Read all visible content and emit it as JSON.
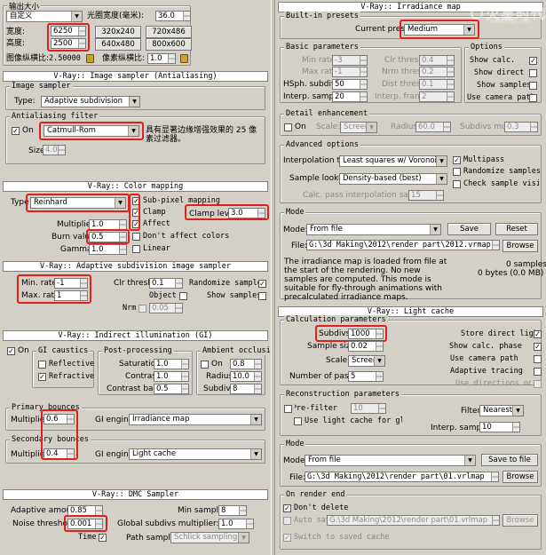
{
  "output": {
    "title": "输出大小",
    "preset": "自定义",
    "aperture_label": "光圈宽度(毫米):",
    "aperture": "36.0",
    "width_label": "宽度:",
    "width": "6250",
    "height_label": "高度:",
    "height": "2500",
    "res": [
      "320x240",
      "720x486",
      "640x480",
      "800x600"
    ],
    "img_aspect_label": "图像纵横比:",
    "img_aspect": "2.50000",
    "px_aspect_label": "像素纵横比:",
    "px_aspect": "1.0"
  },
  "image_sampler": {
    "rollout": "V-Ray:: Image sampler (Antialiasing)",
    "group": "Image sampler",
    "type_label": "Type:",
    "type": "Adaptive subdivision",
    "aa_group": "Antialiasing filter",
    "on_label": "On",
    "on_check": "✓",
    "filter": "Catmull-Rom",
    "desc": "具有显著边缘增强效果的 25 像素过滤器。",
    "size_label": "Size:",
    "size": "4.0"
  },
  "color_mapping": {
    "rollout": "V-Ray:: Color mapping",
    "type_label": "Type",
    "type": "Reinhard",
    "multiplier_label": "Multiplier:",
    "multiplier": "1.0",
    "burn_label": "Burn value:",
    "burn": "0.5",
    "gamma_label": "Gamma:",
    "gamma": "1.0",
    "subpixel": "Sub-pixel mapping",
    "clamp": "Clamp",
    "affect": "Affect",
    "dont_affect": "Don't affect colors",
    "linear": "Linear",
    "check": "✓",
    "clamp_level_label": "Clamp level:",
    "clamp_level": "3.0"
  },
  "adaptive": {
    "rollout": "V-Ray:: Adaptive subdivision image sampler",
    "min_label": "Min. rate:",
    "min": "-1",
    "max_label": "Max. rate:",
    "max": "1",
    "clr_label": "Clr thresh:",
    "clr": "0.1",
    "object_label": "Object",
    "nrm_label": "Nrm",
    "nrm": "0.05",
    "rand_label": "Randomize samples",
    "rand_check": "✓",
    "show_label": "Show samples"
  },
  "gi": {
    "rollout": "V-Ray:: Indirect illumination (GI)",
    "on_label": "On",
    "on_check": "✓",
    "caustics_group": "GI caustics",
    "reflective": "Reflective",
    "refractive": "Refractive",
    "refractive_check": "✓",
    "post_group": "Post-processing",
    "saturation_label": "Saturation",
    "saturation": "1.0",
    "contrast_label": "Contrast",
    "contrast": "1.0",
    "contrast_base_label": "Contrast base",
    "contrast_base": "0.5",
    "ao_group": "Ambient occlusion",
    "ao_on_label": "On",
    "ao_on": "0.8",
    "radius_label": "Radius",
    "radius": "10.0",
    "subdivs_label": "Subdivs",
    "subdivs": "8",
    "primary_group": "Primary bounces",
    "primary_mult_label": "Multiplier",
    "primary_mult": "0.6",
    "gi_engine_label": "GI engine",
    "primary_engine": "Irradiance map",
    "secondary_group": "Secondary bounces",
    "secondary_mult_label": "Multiplier",
    "secondary_mult": "0.4",
    "secondary_engine": "Light cache"
  },
  "dmc": {
    "rollout": "V-Ray:: DMC Sampler",
    "adaptive_label": "Adaptive amount:",
    "adaptive": "0.85",
    "noise_label": "Noise threshold:",
    "noise": "0.001",
    "time_label": "Time",
    "time_check": "✓",
    "min_label": "Min samples:",
    "min": "8",
    "global_label": "Global subdivs multiplier:",
    "global": "1.0",
    "path_label": "Path sampler:",
    "path": "Schlick sampling"
  },
  "irradiance": {
    "rollout": "V-Ray:: Irradiance map",
    "builtin_group": "Built-in presets",
    "preset_label": "Current preset:",
    "preset": "Medium",
    "basic_group": "Basic parameters",
    "min_rate_label": "Min rate:",
    "min_rate": "-3",
    "max_rate_label": "Max rate:",
    "max_rate": "-1",
    "hsph_label": "HSph. subdivs:",
    "hsph": "50",
    "interp_label": "Interp. samples:",
    "interp": "20",
    "clr_label": "Clr thresh:",
    "clr": "0.4",
    "nrm_label": "Nrm thresh:",
    "nrm": "0.2",
    "dist_label": "Dist thresh:",
    "dist": "0.1",
    "frames_label": "Interp. frames:",
    "frames": "2",
    "options_group": "Options",
    "show_calc": "Show calc.",
    "show_calc_check": "✓",
    "show_direct": "Show direct",
    "show_samples": "Show samples",
    "use_camera": "Use camera path",
    "detail_group": "Detail enhancement",
    "detail_on": "On",
    "scale_label": "Scale:",
    "scale": "Screen",
    "radius_label": "Radius",
    "radius": "60.0",
    "subdivs_mult_label": "Subdivs mult.",
    "subdivs_mult": "0.3",
    "adv_group": "Advanced options",
    "interp_type_label": "Interpolation type:",
    "interp_type": "Least squares w/ Voronoi weig",
    "multipass": "Multipass",
    "multipass_check": "✓",
    "lookup_label": "Sample lookup:",
    "lookup": "Density-based (best)",
    "randomize": "Randomize samples",
    "check_vis": "Check sample visibility",
    "calc_pass_label": "Calc. pass interpolation samples:",
    "calc_pass": "15",
    "mode_group": "Mode",
    "mode_label": "Mode:",
    "mode": "From file",
    "save": "Save",
    "reset": "Reset",
    "file_label": "File:",
    "file": "G:\\3d Making\\2012\\render part\\2012.vrmap",
    "browse": "Browse",
    "info": "The irradiance map is loaded from file at the start of the rendering. No new samples are computed. This mode is suitable for fly-through animations with precalculated irradiance maps.",
    "samples": "0 samples",
    "bytes": "0 bytes (0.0 MB)"
  },
  "light_cache": {
    "rollout": "V-Ray:: Light cache",
    "calc_group": "Calculation parameters",
    "subdivs_label": "Subdivs:",
    "subdivs": "1000",
    "sample_size_label": "Sample size:",
    "sample_size": "0.02",
    "scale_label": "Scale:",
    "scale": "Screen",
    "passes_label": "Number of passes:",
    "passes": "5",
    "store_direct": "Store direct light",
    "show_phase": "Show calc. phase",
    "use_camera": "Use camera path",
    "adaptive_tracing": "Adaptive tracing",
    "use_directions": "Use directions only",
    "check": "✓",
    "recon_group": "Reconstruction parameters",
    "prefilter_label": "Pre-filter:",
    "prefilter": "10",
    "use_light_cache": "Use light cache for glossy rays",
    "filter_label": "Filter:",
    "filter": "Nearest",
    "interp_label": "Interp. samples:",
    "interp": "10",
    "mode_group": "Mode",
    "mode_label": "Mode:",
    "mode": "From file",
    "save_to_file": "Save to file",
    "file_label": "File:",
    "file": "G:\\3d Making\\2012\\render part\\01.vrlmap",
    "browse": "Browse",
    "on_end_group": "On render end",
    "dont_delete": "Don't delete",
    "auto_save": "Auto save:",
    "auto_path": "G:\\3d Making\\2012\\render part\\01.vrlmap",
    "browse2": "Browse",
    "switch_saved": "Switch to saved cache"
  },
  "watermark": {
    "text": "火星时代",
    "sub": "www.hxsd.com"
  }
}
